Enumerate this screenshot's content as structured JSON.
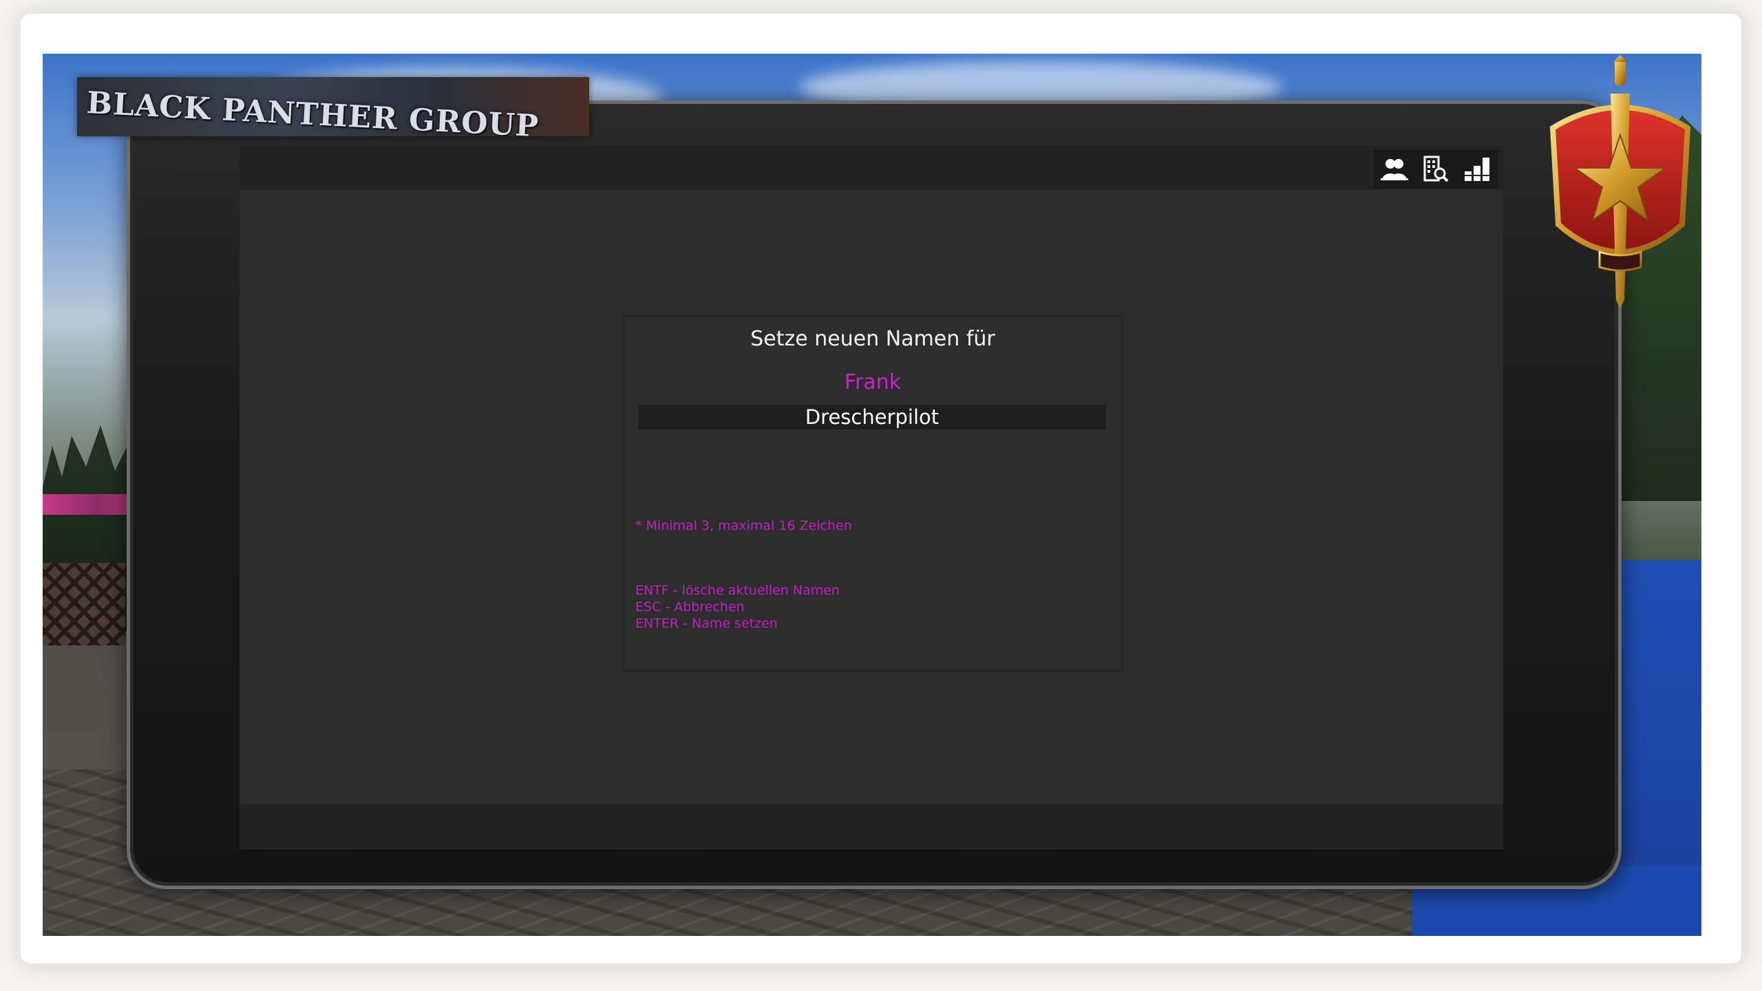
{
  "logo": {
    "text": "BLACK PANTHER GROUP"
  },
  "tablet": {
    "topbar_icons": [
      {
        "name": "players-icon"
      },
      {
        "name": "buildings-icon"
      },
      {
        "name": "statistics-icon"
      }
    ]
  },
  "dialog": {
    "title": "Setze neuen Namen für",
    "player_name": "Frank",
    "input_value": "Drescherpilot",
    "hint_length": "* Minimal 3, maximal 16 Zeichen",
    "shortcuts": [
      "ENTF - lösche aktuellen Namen",
      "ESC - Abbrechen",
      "ENTER - Name setzen"
    ]
  },
  "colors": {
    "accent": "#cc22cc",
    "dialog_bg": "#2d2d2d",
    "input_bg": "#1e1e1e"
  }
}
